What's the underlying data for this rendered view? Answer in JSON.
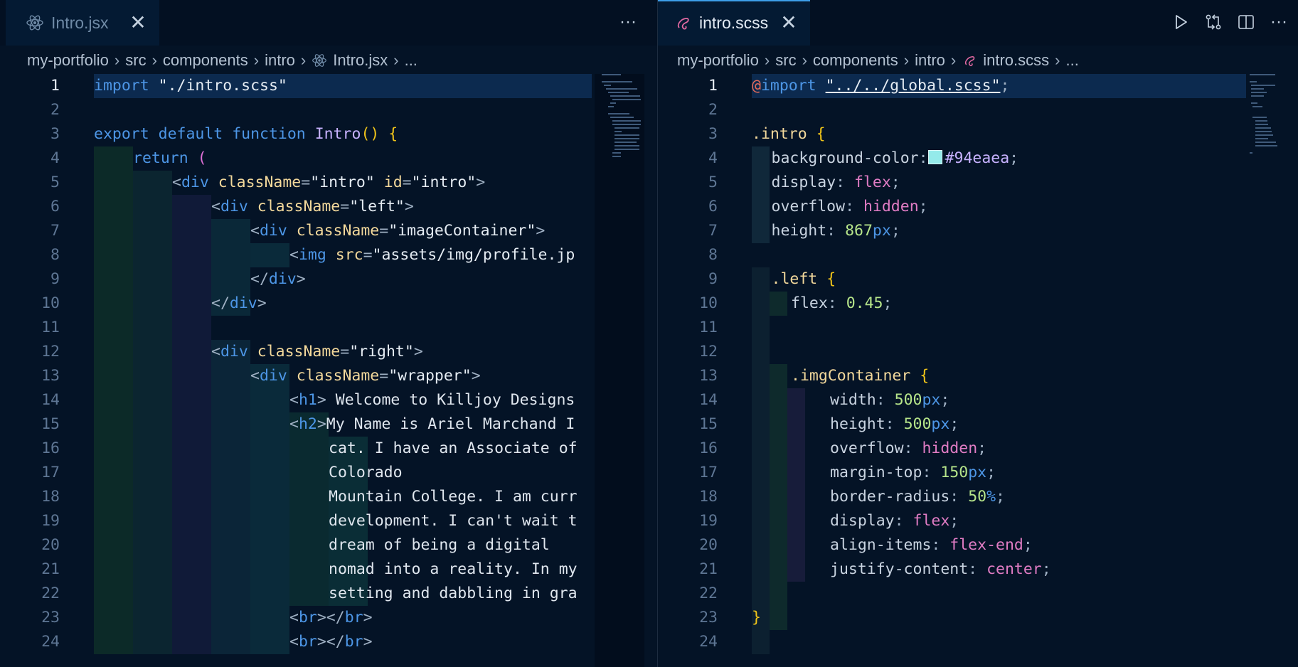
{
  "left_pane": {
    "tab": {
      "label": "Intro.jsx",
      "icon": "react-icon",
      "close": "✕"
    },
    "more_actions": "···",
    "breadcrumb": [
      "my-portfolio",
      "src",
      "components",
      "intro",
      "Intro.jsx",
      "..."
    ],
    "lines": [
      {
        "n": "1",
        "text": "import \"./intro.scss\""
      },
      {
        "n": "2",
        "text": ""
      },
      {
        "n": "3",
        "text": "export default function Intro() {"
      },
      {
        "n": "4",
        "text": "return ("
      },
      {
        "n": "5",
        "text": "<div className=\"intro\" id=\"intro\">"
      },
      {
        "n": "6",
        "text": "<div className=\"left\">"
      },
      {
        "n": "7",
        "text": "<div className=\"imageContainer\">"
      },
      {
        "n": "8",
        "text": "<img src=\"assets/img/profile.jp"
      },
      {
        "n": "9",
        "text": "</div>"
      },
      {
        "n": "10",
        "text": "</div>"
      },
      {
        "n": "11",
        "text": ""
      },
      {
        "n": "12",
        "text": "<div className=\"right\">"
      },
      {
        "n": "13",
        "text": "<div className=\"wrapper\">"
      },
      {
        "n": "14",
        "text": "<h1> Welcome to Killjoy Designs"
      },
      {
        "n": "15",
        "text": "<h2>My Name is Ariel Marchand I"
      },
      {
        "n": "16",
        "text": "cat. I have an Associate of"
      },
      {
        "n": "17",
        "text": "Colorado"
      },
      {
        "n": "18",
        "text": "Mountain College. I am curr"
      },
      {
        "n": "19",
        "text": "development. I can't wait t"
      },
      {
        "n": "20",
        "text": "dream of being a digital"
      },
      {
        "n": "21",
        "text": "nomad into a reality. In my"
      },
      {
        "n": "22",
        "text": "setting and dabbling in gra"
      },
      {
        "n": "23",
        "text": "<br></br>"
      },
      {
        "n": "24",
        "text": "<br></br>"
      }
    ]
  },
  "right_pane": {
    "tab": {
      "label": "intro.scss",
      "icon": "sass-icon",
      "close": "✕"
    },
    "breadcrumb": [
      "my-portfolio",
      "src",
      "components",
      "intro",
      "intro.scss",
      "..."
    ],
    "actions": {
      "run": "run-icon",
      "compare": "compare-changes-icon",
      "split": "split-editor-icon",
      "more": "···"
    },
    "lines": [
      {
        "n": "1",
        "text": "@import \"../../global.scss\";"
      },
      {
        "n": "2",
        "text": ""
      },
      {
        "n": "3",
        "text": ".intro {"
      },
      {
        "n": "4",
        "text": "background-color: #94eaea;"
      },
      {
        "n": "5",
        "text": "display: flex;"
      },
      {
        "n": "6",
        "text": "overflow: hidden;"
      },
      {
        "n": "7",
        "text": "height: 867px;"
      },
      {
        "n": "8",
        "text": ""
      },
      {
        "n": "9",
        "text": ".left {"
      },
      {
        "n": "10",
        "text": "flex: 0.45;"
      },
      {
        "n": "11",
        "text": ""
      },
      {
        "n": "12",
        "text": ""
      },
      {
        "n": "13",
        "text": ".imgContainer {"
      },
      {
        "n": "14",
        "text": "width: 500px;"
      },
      {
        "n": "15",
        "text": "height: 500px;"
      },
      {
        "n": "16",
        "text": "overflow: hidden;"
      },
      {
        "n": "17",
        "text": "margin-top: 150px;"
      },
      {
        "n": "18",
        "text": "border-radius: 50%;"
      },
      {
        "n": "19",
        "text": "display: flex;"
      },
      {
        "n": "20",
        "text": "align-items: flex-end;"
      },
      {
        "n": "21",
        "text": "justify-content: center;"
      },
      {
        "n": "22",
        "text": ""
      },
      {
        "n": "23",
        "text": "}"
      },
      {
        "n": "24",
        "text": ""
      }
    ]
  },
  "colors": {
    "background": "#041326",
    "accent": "#3d9ee8",
    "swatch": "#94eaea",
    "keyword": "#4d96e6",
    "function": "#c7b2ff",
    "attribute": "#f2d89b",
    "value": "#e07cc4",
    "number": "#b6e58a"
  }
}
